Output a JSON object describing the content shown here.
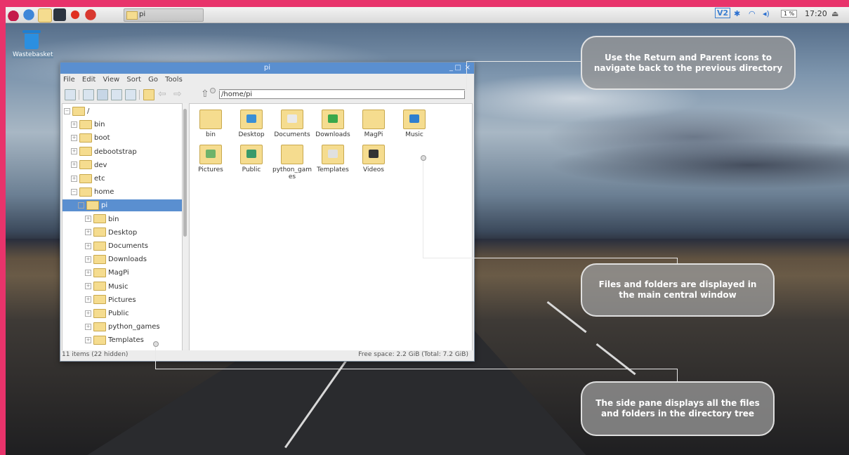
{
  "taskbar": {
    "task_label": "pi",
    "tray_vnc": "V2",
    "tray_cpu": "1 %",
    "clock": "17:20"
  },
  "desktop": {
    "wastebasket_label": "Wastebasket"
  },
  "window": {
    "title": "pi",
    "menu": [
      "File",
      "Edit",
      "View",
      "Sort",
      "Go",
      "Tools"
    ],
    "path": "/home/pi",
    "tree": [
      {
        "label": "/",
        "depth": 0,
        "exp": "⊟"
      },
      {
        "label": "bin",
        "depth": 1,
        "exp": "⊞"
      },
      {
        "label": "boot",
        "depth": 1,
        "exp": "⊞"
      },
      {
        "label": "debootstrap",
        "depth": 1,
        "exp": "⊞"
      },
      {
        "label": "dev",
        "depth": 1,
        "exp": "⊞"
      },
      {
        "label": "etc",
        "depth": 1,
        "exp": "⊞"
      },
      {
        "label": "home",
        "depth": 1,
        "exp": "⊟"
      },
      {
        "label": "pi",
        "depth": 2,
        "exp": "⊟",
        "selected": true
      },
      {
        "label": "bin",
        "depth": 3,
        "exp": "⊞"
      },
      {
        "label": "Desktop",
        "depth": 3,
        "exp": "⊞"
      },
      {
        "label": "Documents",
        "depth": 3,
        "exp": "⊞"
      },
      {
        "label": "Downloads",
        "depth": 3,
        "exp": "⊞"
      },
      {
        "label": "MagPi",
        "depth": 3,
        "exp": "⊞"
      },
      {
        "label": "Music",
        "depth": 3,
        "exp": "⊞"
      },
      {
        "label": "Pictures",
        "depth": 3,
        "exp": "⊞"
      },
      {
        "label": "Public",
        "depth": 3,
        "exp": "⊞"
      },
      {
        "label": "python_games",
        "depth": 3,
        "exp": "⊞"
      },
      {
        "label": "Templates",
        "depth": 3,
        "exp": "⊞"
      }
    ],
    "items": [
      {
        "label": "bin"
      },
      {
        "label": "Desktop",
        "badge": "#3a8fd6"
      },
      {
        "label": "Documents",
        "badge": "#e9e9e9"
      },
      {
        "label": "Downloads",
        "badge": "#3aa84a"
      },
      {
        "label": "MagPi"
      },
      {
        "label": "Music",
        "badge": "#2f7fcf"
      },
      {
        "label": "Pictures",
        "badge": "#6fb36a"
      },
      {
        "label": "Public",
        "badge": "#3a9a6a"
      },
      {
        "label": "python_gam es"
      },
      {
        "label": "Templates",
        "badge": "#e0e0e0"
      },
      {
        "label": "Videos",
        "badge": "#333333"
      }
    ],
    "status_left": "11 items (22 hidden)",
    "status_right": "Free space: 2.2 GiB (Total: 7.2 GiB)"
  },
  "callouts": {
    "top": "Use the Return and Parent icons to navigate back to the previous directory",
    "middle": "Files and folders are displayed in the main central window",
    "bottom": "The side pane displays all the files and folders in the directory tree"
  },
  "colors": {
    "frame": "#e8336b",
    "selection": "#5a8fd0",
    "folder": "#f5dc8f"
  }
}
